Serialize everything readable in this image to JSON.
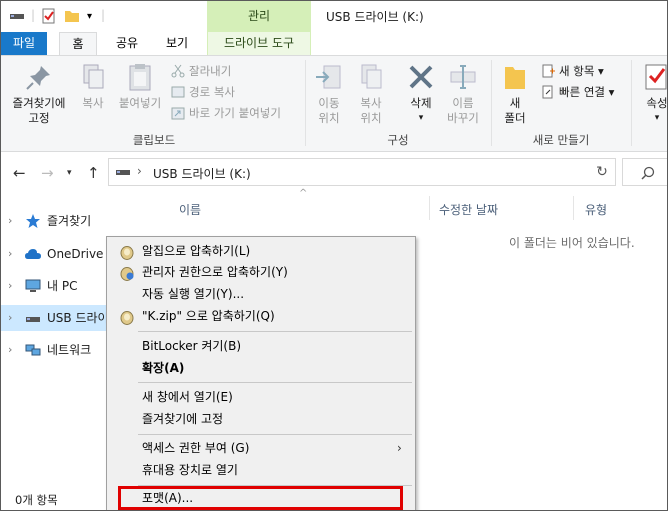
{
  "window": {
    "title": "USB 드라이브 (K:)",
    "contextual_tab_group": "관리"
  },
  "ribbon_tabs": [
    "파일",
    "홈",
    "공유",
    "보기",
    "드라이브 도구"
  ],
  "ribbon": {
    "clipboard": {
      "label": "클립보드",
      "pin_quick_access": "즐겨찾기에\n고정",
      "copy": "복사",
      "paste": "붙여넣기",
      "cut": "잘라내기",
      "copy_path": "경로 복사",
      "paste_shortcut": "바로 가기 붙여넣기"
    },
    "organize": {
      "label": "구성",
      "move_to": "이동\n위치",
      "copy_to": "복사\n위치",
      "delete": "삭제",
      "rename": "이름\n바꾸기"
    },
    "new": {
      "label": "새로 만들기",
      "new_folder": "새\n폴더",
      "new_item": "새 항목",
      "easy_access": "빠른 연결"
    },
    "open": {
      "properties": "속성"
    }
  },
  "address": {
    "path": "USB 드라이브 (K:)"
  },
  "nav_pane": [
    {
      "label": "즐겨찾기",
      "icon": "star-icon"
    },
    {
      "label": "OneDrive - ",
      "icon": "cloud-icon"
    },
    {
      "label": "내 PC",
      "icon": "computer-icon"
    },
    {
      "label": "USB 드라이",
      "icon": "usb-drive-icon",
      "selected": true
    },
    {
      "label": "네트워크",
      "icon": "network-icon"
    }
  ],
  "columns": [
    "이름",
    "수정한 날짜",
    "유형"
  ],
  "empty_message": "이 폴더는 비어 있습니다.",
  "status_bar": "0개 항목",
  "context_menu": [
    {
      "label": "알집으로 압축하기(L)",
      "icon": "alzip-icon"
    },
    {
      "label": "관리자 권한으로 압축하기(Y)",
      "icon": "alzip-admin-icon"
    },
    {
      "label": "자동 실행 열기(Y)..."
    },
    {
      "label": "\"K.zip\" 으로 압축하기(Q)",
      "icon": "alzip-icon"
    },
    {
      "label": "BitLocker 켜기(B)"
    },
    {
      "label": "확장(A)",
      "bold": true
    },
    {
      "label": "새 창에서 열기(E)"
    },
    {
      "label": "즐겨찾기에 고정"
    },
    {
      "label": "액세스 권한 부여 (G)",
      "submenu": true
    },
    {
      "label": "휴대용 장치로 열기"
    },
    {
      "label": "포맷(A)..."
    }
  ],
  "colors": {
    "file_tab": "#1979ca",
    "drive_tools_tab": "#d5efb8",
    "selection": "#cce8ff",
    "highlight_box": "#e00000"
  }
}
